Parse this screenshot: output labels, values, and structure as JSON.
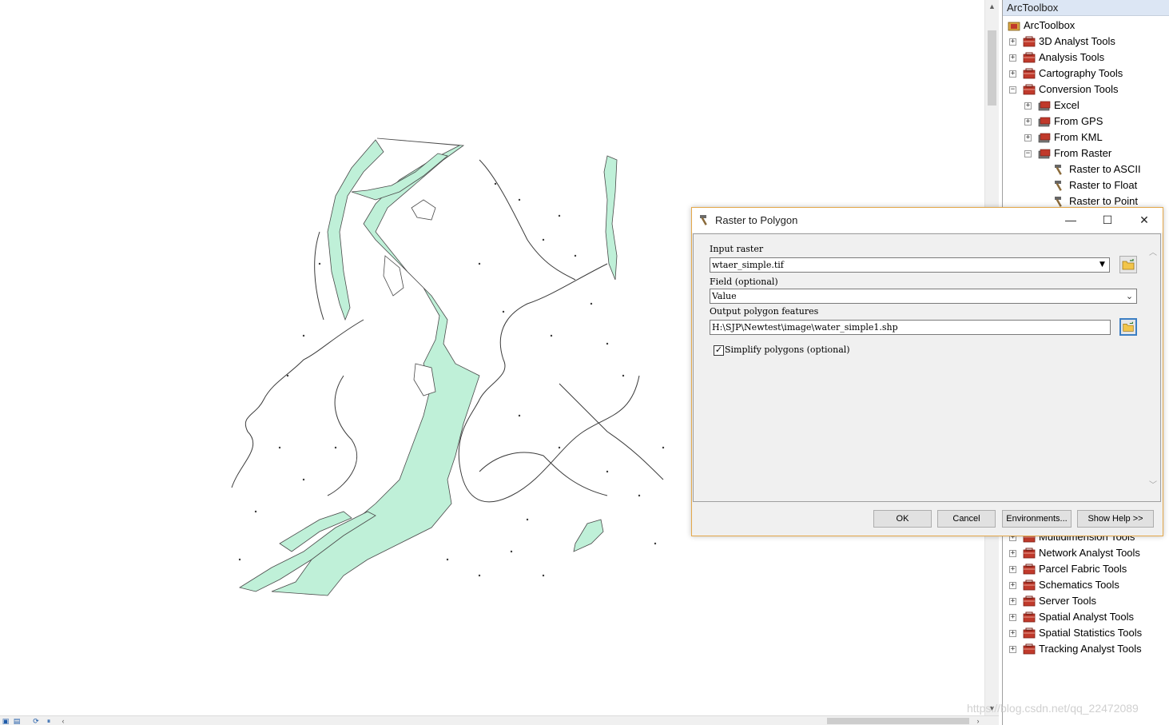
{
  "toolbox": {
    "title": "ArcToolbox",
    "root": "ArcToolbox",
    "items_top": [
      {
        "label": "3D Analyst Tools",
        "expander": "+"
      },
      {
        "label": "Analysis Tools",
        "expander": "+"
      },
      {
        "label": "Cartography Tools",
        "expander": "+"
      },
      {
        "label": "Conversion Tools",
        "expander": "−"
      },
      {
        "label": "Excel",
        "expander": "+"
      },
      {
        "label": "From GPS",
        "expander": "+"
      },
      {
        "label": "From KML",
        "expander": "+"
      },
      {
        "label": "From Raster",
        "expander": "−"
      },
      {
        "label": "Raster to ASCII"
      },
      {
        "label": "Raster to Float"
      },
      {
        "label": "Raster to Point"
      }
    ],
    "items_bottom": [
      {
        "label": "Multidimension Tools",
        "expander": "+"
      },
      {
        "label": "Network Analyst Tools",
        "expander": "+"
      },
      {
        "label": "Parcel Fabric Tools",
        "expander": "+"
      },
      {
        "label": "Schematics Tools",
        "expander": "+"
      },
      {
        "label": "Server Tools",
        "expander": "+"
      },
      {
        "label": "Spatial Analyst Tools",
        "expander": "+"
      },
      {
        "label": "Spatial Statistics Tools",
        "expander": "+"
      },
      {
        "label": "Tracking Analyst Tools",
        "expander": "+"
      }
    ]
  },
  "dialog": {
    "title": "Raster to Polygon",
    "minimize": "—",
    "maximize": "☐",
    "close": "✕",
    "input_raster_label": "Input raster",
    "input_raster_value": "wtaer_simple.tif",
    "field_label": "Field (optional)",
    "field_value": "Value",
    "output_label": "Output polygon features",
    "output_value": "H:\\SJP\\Newtest\\image\\water_simple1.shp",
    "simplify_label": "Simplify polygons (optional)",
    "simplify_checked": "✓",
    "buttons": {
      "ok": "OK",
      "cancel": "Cancel",
      "environments": "Environments...",
      "show_help": "Show Help >>"
    }
  },
  "watermark": "https://blog.csdn.net/qq_22472089",
  "colors": {
    "water_fill": "#bff0d8",
    "water_stroke": "#4a4a4a",
    "toolbox_title_bg": "#dce6f4",
    "dialog_border": "#e4a84a"
  }
}
